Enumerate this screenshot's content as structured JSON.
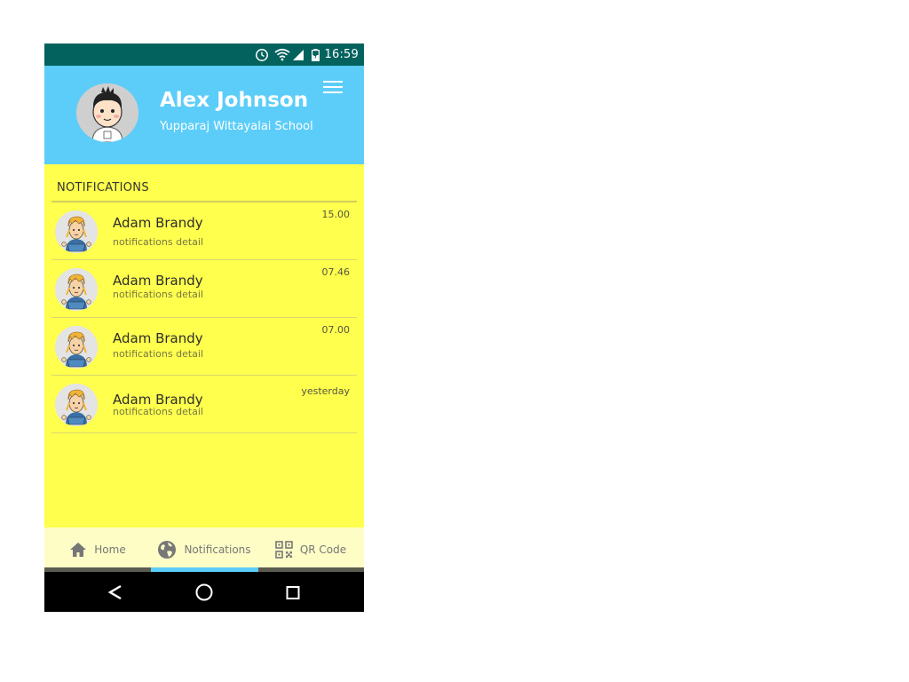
{
  "status_bar": {
    "time": "16:59",
    "icons": [
      "alarm-icon",
      "wifi-icon",
      "cell-signal-icon",
      "battery-charging-icon"
    ]
  },
  "header": {
    "name": "Alex Johnson",
    "school": "Yupparaj Wittayalai School",
    "menu_icon": "hamburger-menu-icon"
  },
  "notifications": {
    "title": "NOTIFICATIONS",
    "items": [
      {
        "name": "Adam Brandy",
        "detail": "notifications detail",
        "time": "15.00"
      },
      {
        "name": "Adam Brandy",
        "detail": "notifications detail",
        "time": "07.46"
      },
      {
        "name": "Adam Brandy",
        "detail": "notifications detail",
        "time": "07.00"
      },
      {
        "name": "Adam Brandy",
        "detail": "notifications detail",
        "time": "yesterday"
      }
    ]
  },
  "bottom_nav": {
    "tabs": [
      {
        "label": "Home",
        "icon": "home-icon"
      },
      {
        "label": "Notifications",
        "icon": "globe-icon"
      },
      {
        "label": "QR Code",
        "icon": "qr-code-icon"
      }
    ],
    "active": "Notifications"
  },
  "system_nav": {
    "icons": [
      "back-icon",
      "home-circle-icon",
      "recents-icon"
    ]
  },
  "colors": {
    "status_bar": "#03625e",
    "header": "#5ccdf9",
    "content_bg": "#ffff4d",
    "bottom_nav_bg": "#fefdc6",
    "active_indicator": "#5ccdf9"
  }
}
